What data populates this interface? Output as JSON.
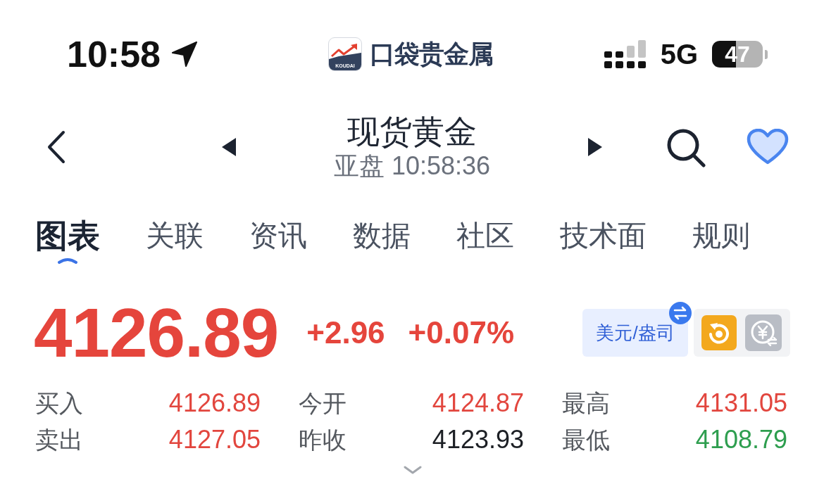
{
  "status_bar": {
    "time": "10:58",
    "network": "5G",
    "battery": "47"
  },
  "app_logo": {
    "caption": "KOUDAI",
    "name": "口袋贵金属"
  },
  "header": {
    "title": "现货黄金",
    "subtitle": "亚盘 10:58:36",
    "favorited": true
  },
  "tabs": [
    {
      "label": "图表",
      "selected": true
    },
    {
      "label": "关联",
      "selected": false
    },
    {
      "label": "资讯",
      "selected": false
    },
    {
      "label": "数据",
      "selected": false
    },
    {
      "label": "社区",
      "selected": false
    },
    {
      "label": "技术面",
      "selected": false
    },
    {
      "label": "规则",
      "selected": false
    }
  ],
  "quote": {
    "price": "4126.89",
    "change": "+2.96",
    "change_percent": "+0.07%",
    "unit_toggle": "美元/盎司"
  },
  "stats": [
    {
      "label": "买入",
      "value": "4126.89",
      "color": "#e2463e"
    },
    {
      "label": "今开",
      "value": "4124.87",
      "color": "#e2463e"
    },
    {
      "label": "最高",
      "value": "4131.05",
      "color": "#e2463e"
    },
    {
      "label": "卖出",
      "value": "4127.05",
      "color": "#e2463e"
    },
    {
      "label": "昨收",
      "value": "4123.93",
      "color": "#1c1f24"
    },
    {
      "label": "最低",
      "value": "4108.79",
      "color": "#2e9e4f"
    }
  ]
}
